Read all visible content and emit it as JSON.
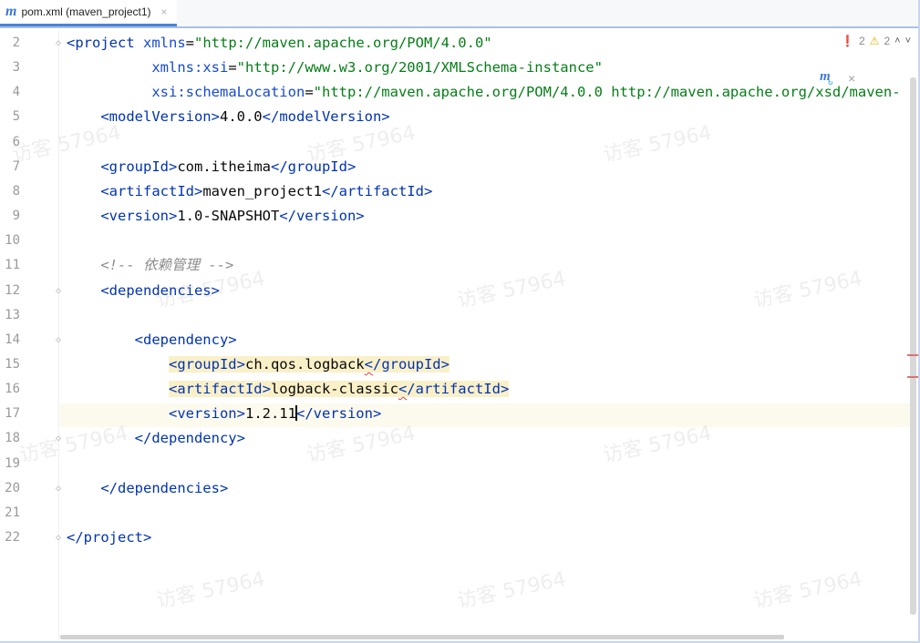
{
  "tab": {
    "icon_glyph": "m",
    "title": "pom.xml (maven_project1)",
    "close": "×"
  },
  "inspection": {
    "errors": "2",
    "warnings": "2",
    "error_icon": "error-circle-icon",
    "warning_icon": "warning-triangle-icon"
  },
  "maven_popup": {
    "icon_glyph": "m",
    "close": "×"
  },
  "lines": [
    {
      "n": "2",
      "parts": [
        [
          "tag",
          "<project "
        ],
        [
          "attr",
          "xmlns"
        ],
        [
          "plain",
          "="
        ],
        [
          "aval",
          "\"http://maven.apache.org/POM/4.0.0\""
        ]
      ]
    },
    {
      "n": "3",
      "parts": [
        [
          "plain",
          "          "
        ],
        [
          "attr",
          "xmlns:xsi"
        ],
        [
          "plain",
          "="
        ],
        [
          "aval",
          "\"http://www.w3.org/2001/XMLSchema-instance\""
        ]
      ]
    },
    {
      "n": "4",
      "parts": [
        [
          "plain",
          "          "
        ],
        [
          "attr",
          "xsi:schemaLocation"
        ],
        [
          "plain",
          "="
        ],
        [
          "aval",
          "\"http://maven.apache.org/POM/4.0.0 http://maven.apache.org/xsd/maven-"
        ]
      ]
    },
    {
      "n": "5",
      "parts": [
        [
          "plain",
          "    "
        ],
        [
          "tag",
          "<modelVersion>"
        ],
        [
          "plain",
          "4.0.0"
        ],
        [
          "tag",
          "</modelVersion>"
        ]
      ]
    },
    {
      "n": "6",
      "parts": []
    },
    {
      "n": "7",
      "parts": [
        [
          "plain",
          "    "
        ],
        [
          "tag",
          "<groupId>"
        ],
        [
          "plain",
          "com.itheima"
        ],
        [
          "tag",
          "</groupId>"
        ]
      ]
    },
    {
      "n": "8",
      "parts": [
        [
          "plain",
          "    "
        ],
        [
          "tag",
          "<artifactId>"
        ],
        [
          "plain",
          "maven_project1"
        ],
        [
          "tag",
          "</artifactId>"
        ]
      ]
    },
    {
      "n": "9",
      "parts": [
        [
          "plain",
          "    "
        ],
        [
          "tag",
          "<version>"
        ],
        [
          "plain",
          "1.0-SNAPSHOT"
        ],
        [
          "tag",
          "</version>"
        ]
      ]
    },
    {
      "n": "10",
      "parts": []
    },
    {
      "n": "11",
      "parts": [
        [
          "plain",
          "    "
        ],
        [
          "comment",
          "<!-- 依赖管理 -->"
        ]
      ]
    },
    {
      "n": "12",
      "parts": [
        [
          "plain",
          "    "
        ],
        [
          "tag",
          "<dependencies>"
        ]
      ]
    },
    {
      "n": "13",
      "parts": []
    },
    {
      "n": "14",
      "parts": [
        [
          "plain",
          "        "
        ],
        [
          "tag",
          "<dependency>"
        ]
      ]
    },
    {
      "n": "15",
      "parts": [
        [
          "plain",
          "            "
        ],
        [
          "tag hl",
          "<groupId>"
        ],
        [
          "plain hl",
          "ch.qos.logback"
        ],
        [
          "tag hl squig",
          "<"
        ],
        [
          "tag hl",
          "/groupId>"
        ]
      ]
    },
    {
      "n": "16",
      "parts": [
        [
          "plain",
          "            "
        ],
        [
          "tag hl",
          "<artifactId>"
        ],
        [
          "plain hl",
          "logback-classic"
        ],
        [
          "tag hl squig",
          "<"
        ],
        [
          "tag hl",
          "/artifactId>"
        ]
      ]
    },
    {
      "n": "17",
      "parts": [
        [
          "plain",
          "            "
        ],
        [
          "tag",
          "<version>"
        ],
        [
          "plain",
          "1.2.11"
        ],
        [
          "caret",
          ""
        ],
        [
          "tag",
          "</version>"
        ]
      ]
    },
    {
      "n": "18",
      "parts": [
        [
          "plain",
          "        "
        ],
        [
          "tag",
          "</dependency>"
        ]
      ]
    },
    {
      "n": "19",
      "parts": []
    },
    {
      "n": "20",
      "parts": [
        [
          "plain",
          "    "
        ],
        [
          "tag",
          "</dependencies>"
        ]
      ]
    },
    {
      "n": "21",
      "parts": []
    },
    {
      "n": "22",
      "parts": [
        [
          "tag",
          "</project>"
        ]
      ]
    }
  ],
  "watermark": "访客 57964"
}
